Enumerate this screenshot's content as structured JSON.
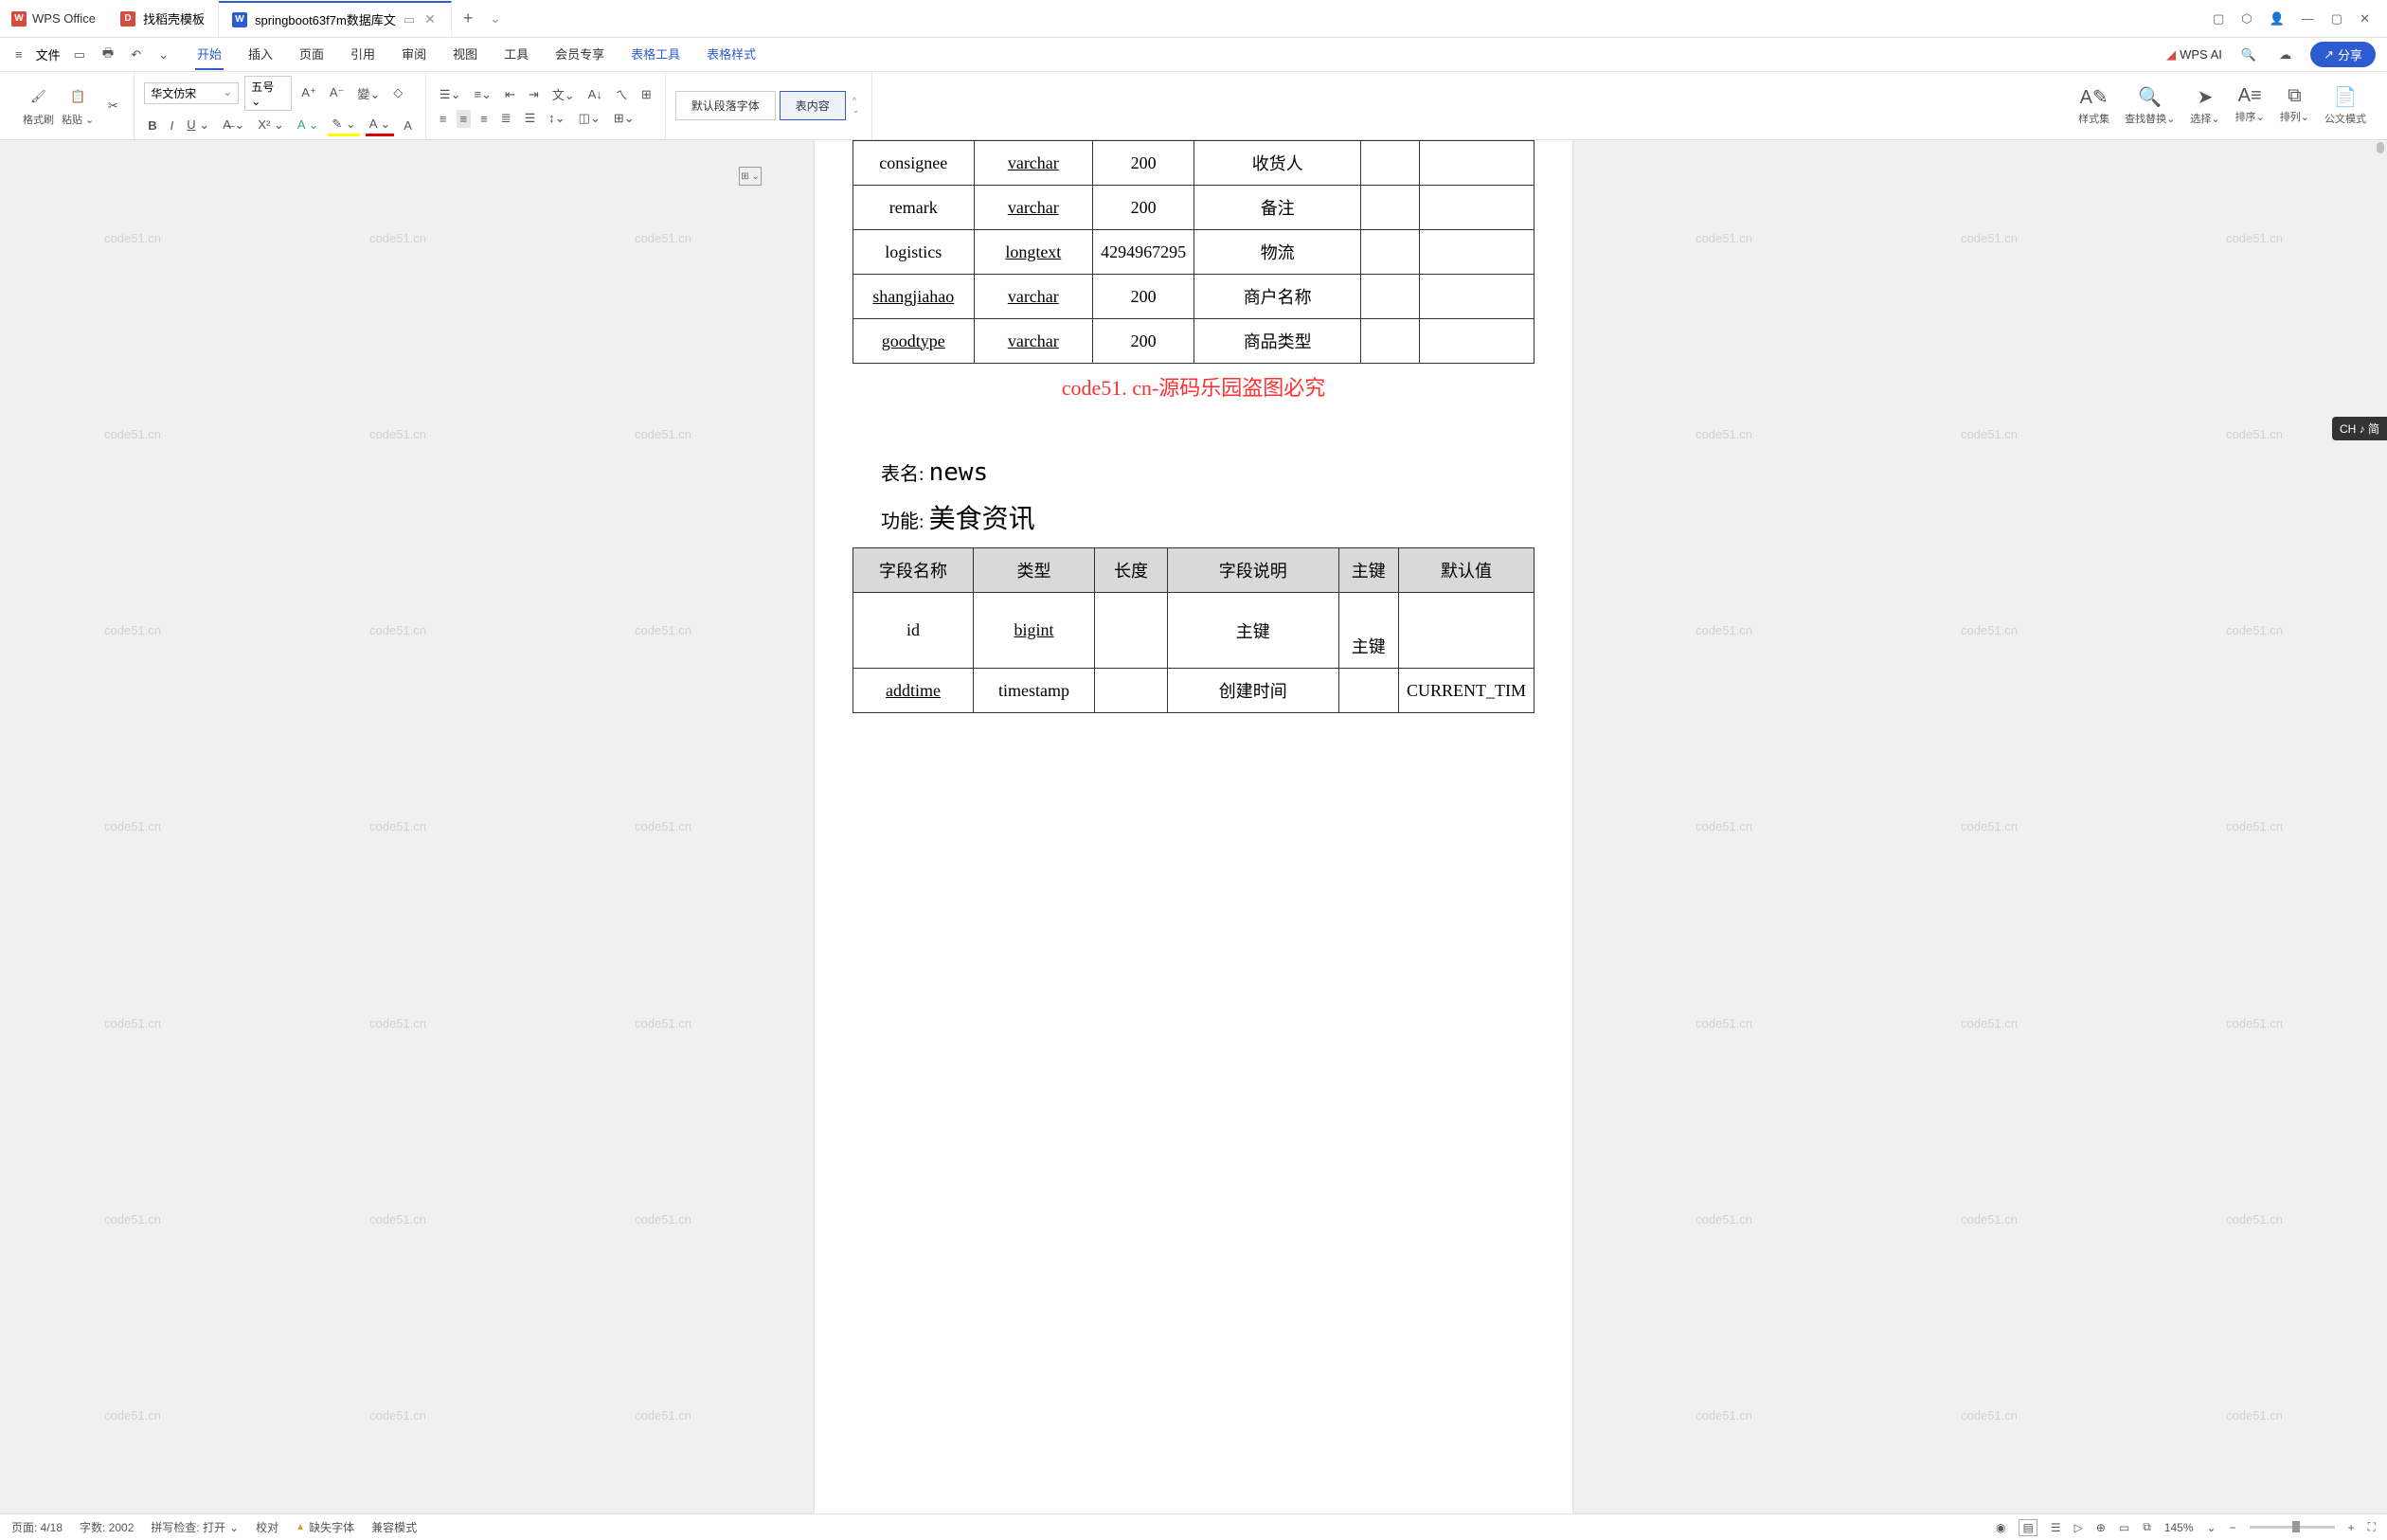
{
  "title_bar": {
    "app_name": "WPS Office",
    "tabs": [
      {
        "icon": "red",
        "icon_char": "D",
        "label": "找稻壳模板"
      },
      {
        "icon": "blue",
        "icon_char": "W",
        "label": "springboot63f7m数据库文"
      }
    ]
  },
  "menu": {
    "items": [
      "开始",
      "插入",
      "页面",
      "引用",
      "审阅",
      "视图",
      "工具",
      "会员专享",
      "表格工具",
      "表格样式"
    ],
    "active": 0,
    "file_label": "文件",
    "wps_ai": "WPS AI",
    "share": "分享"
  },
  "ribbon": {
    "brush": "格式刷",
    "paste": "粘贴",
    "font_name": "华文仿宋",
    "font_size": "五号",
    "style_default": "默认段落字体",
    "style_content": "表内容",
    "styles": "样式集",
    "find": "查找替换",
    "select": "选择",
    "sort": "排序",
    "align": "排列",
    "official": "公文模式"
  },
  "doc": {
    "watermark_text": "code51.cn",
    "watermark_banner": "code51. cn-源码乐园盗图必究",
    "table1": {
      "rows": [
        {
          "c1": "consignee",
          "c2": "varchar",
          "c3": "200",
          "c4": "收货人",
          "c5": "",
          "c6": ""
        },
        {
          "c1": "remark",
          "c2": "varchar",
          "c3": "200",
          "c4": "备注",
          "c5": "",
          "c6": ""
        },
        {
          "c1": "logistics",
          "c2": "longtext",
          "c3": "4294967295",
          "c4": "物流",
          "c5": "",
          "c6": ""
        },
        {
          "c1": "shangjiahao",
          "c2": "varchar",
          "c3": "200",
          "c4": "商户名称",
          "c5": "",
          "c6": ""
        },
        {
          "c1": "goodtype",
          "c2": "varchar",
          "c3": "200",
          "c4": "商品类型",
          "c5": "",
          "c6": ""
        }
      ]
    },
    "table2_name_label": "表名:",
    "table2_name": "news",
    "table2_func_label": "功能:",
    "table2_func": "美食资讯",
    "table2": {
      "headers": [
        "字段名称",
        "类型",
        "长度",
        "字段说明",
        "主键",
        "默认值"
      ],
      "rows": [
        {
          "c1": "id",
          "c2": "bigint",
          "c3": "",
          "c4": "主键",
          "c5": "主键",
          "c6": ""
        },
        {
          "c1": "addtime",
          "c2": "timestamp",
          "c3": "",
          "c4": "创建时间",
          "c5": "",
          "c6": "CURRENT_TIM"
        }
      ]
    }
  },
  "status": {
    "page": "页面: 4/18",
    "words": "字数: 2002",
    "spell": "拼写检查: 打开",
    "proof": "校对",
    "font_missing": "缺失字体",
    "compat": "兼容模式",
    "zoom": "145%"
  },
  "right_badge": "CH ♪ 简"
}
